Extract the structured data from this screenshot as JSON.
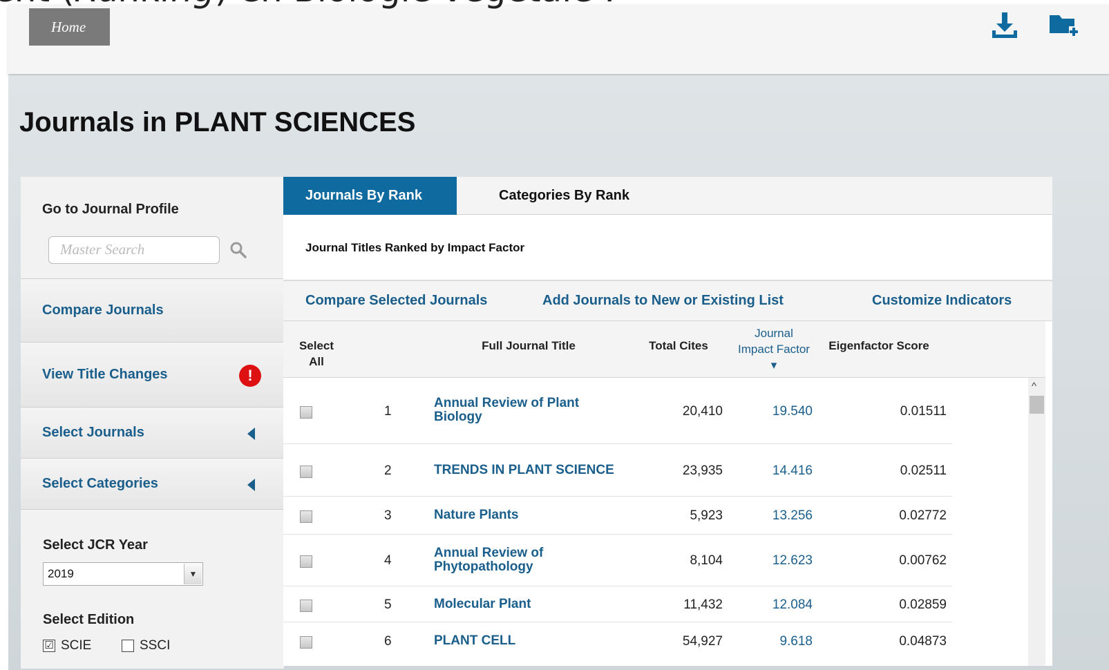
{
  "overlay": {
    "prefix": "ent (",
    "italic": "Ranking",
    "suffix": ") en Biologie végétale :"
  },
  "topbar": {
    "home_label": "Home",
    "download_icon": "download-icon",
    "folder_add_icon": "folder-add-icon"
  },
  "page": {
    "title": "Journals in PLANT SCIENCES"
  },
  "sidebar": {
    "profile_label": "Go to Journal Profile",
    "search_placeholder": "Master Search",
    "compare_label": "Compare Journals",
    "title_changes_label": "View Title Changes",
    "alert_glyph": "!",
    "select_journals_label": "Select Journals",
    "select_categories_label": "Select Categories",
    "year_label": "Select JCR Year",
    "year_value": "2019",
    "edition_label": "Select Edition",
    "editions": [
      {
        "label": "SCIE",
        "checked": true,
        "mark": "☑"
      },
      {
        "label": "SSCI",
        "checked": false,
        "mark": ""
      }
    ]
  },
  "tabs": [
    {
      "label": "Journals By Rank",
      "active": true
    },
    {
      "label": "Categories By Rank",
      "active": false
    }
  ],
  "main": {
    "ranked_by": "Journal Titles Ranked by Impact Factor",
    "actions": {
      "compare": "Compare Selected Journals",
      "add_list": "Add Journals to New or Existing List",
      "customize": "Customize Indicators"
    }
  },
  "table": {
    "headers": {
      "select_all": "Select All",
      "full_title": "Full Journal Title",
      "total_cites": "Total Cites",
      "jif": "Journal Impact Factor",
      "eigen": "Eigenfactor Score"
    },
    "rows": [
      {
        "rank": "1",
        "title": "Annual Review of Plant Biology",
        "cites": "20,410",
        "jif": "19.540",
        "eigen": "0.01511"
      },
      {
        "rank": "2",
        "title": "TRENDS IN PLANT SCIENCE",
        "cites": "23,935",
        "jif": "14.416",
        "eigen": "0.02511"
      },
      {
        "rank": "3",
        "title": "Nature Plants",
        "cites": "5,923",
        "jif": "13.256",
        "eigen": "0.02772"
      },
      {
        "rank": "4",
        "title": "Annual Review of Phytopathology",
        "cites": "8,104",
        "jif": "12.623",
        "eigen": "0.00762"
      },
      {
        "rank": "5",
        "title": "Molecular Plant",
        "cites": "11,432",
        "jif": "12.084",
        "eigen": "0.02859"
      },
      {
        "rank": "6",
        "title": "PLANT CELL",
        "cites": "54,927",
        "jif": "9.618",
        "eigen": "0.04873"
      }
    ]
  },
  "colors": {
    "accent": "#0f6a9f",
    "link": "#1a5e8c",
    "alert": "#dd1111"
  }
}
